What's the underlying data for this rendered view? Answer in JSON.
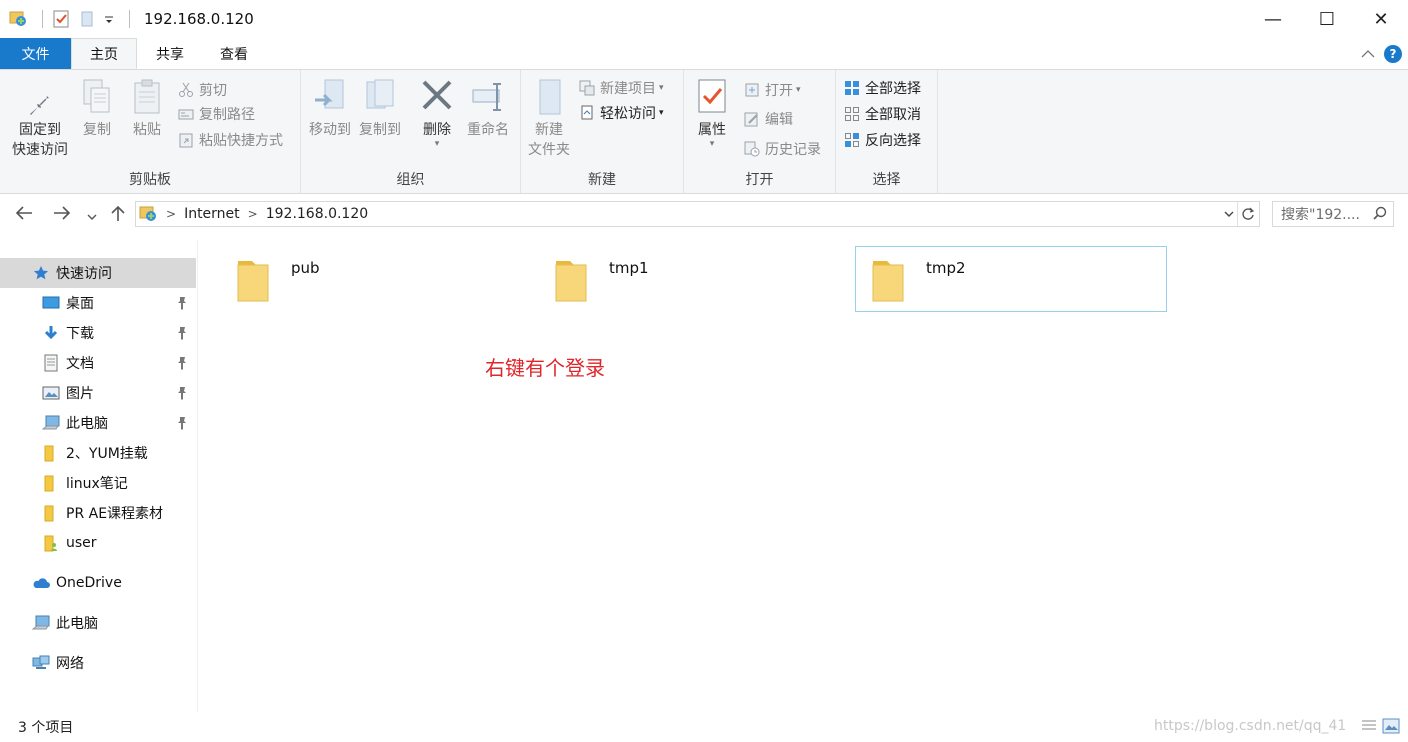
{
  "window": {
    "title": "192.168.0.120",
    "controls": {
      "minimize": "—",
      "maximize": "☐",
      "close": "✕"
    }
  },
  "ribbon_tabs": [
    {
      "label": "文件"
    },
    {
      "label": "主页"
    },
    {
      "label": "共享"
    },
    {
      "label": "查看"
    }
  ],
  "ribbon": {
    "clipboard": {
      "label": "剪贴板",
      "pin_quick_line1": "固定到",
      "pin_quick_line2": "快速访问",
      "copy": "复制",
      "paste": "粘贴",
      "cut": "剪切",
      "copy_path": "复制路径",
      "paste_shortcut": "粘贴快捷方式"
    },
    "organize": {
      "label": "组织",
      "move_to": "移动到",
      "copy_to": "复制到",
      "delete": "删除",
      "rename": "重命名"
    },
    "new": {
      "label": "新建",
      "new_folder_line1": "新建",
      "new_folder_line2": "文件夹",
      "new_item": "新建项目",
      "easy_access": "轻松访问"
    },
    "open": {
      "label": "打开",
      "properties": "属性",
      "open": "打开",
      "edit": "编辑",
      "history": "历史记录"
    },
    "select": {
      "label": "选择",
      "select_all": "全部选择",
      "select_none": "全部取消",
      "invert": "反向选择"
    }
  },
  "address": {
    "crumbs": [
      "Internet",
      "192.168.0.120"
    ],
    "search_placeholder": "搜索\"192...."
  },
  "sidebar": {
    "items": [
      {
        "label": "快速访问",
        "icon": "star-icon",
        "pinned": false
      },
      {
        "label": "桌面",
        "icon": "desktop-icon",
        "pinned": true
      },
      {
        "label": "下载",
        "icon": "download-icon",
        "pinned": true
      },
      {
        "label": "文档",
        "icon": "document-icon",
        "pinned": true
      },
      {
        "label": "图片",
        "icon": "picture-icon",
        "pinned": true
      },
      {
        "label": "此电脑",
        "icon": "computer-icon",
        "pinned": true
      },
      {
        "label": "2、YUM挂载",
        "icon": "folder-icon",
        "pinned": false
      },
      {
        "label": "linux笔记",
        "icon": "folder-icon",
        "pinned": false
      },
      {
        "label": "PR AE课程素材",
        "icon": "folder-icon",
        "pinned": false
      },
      {
        "label": "user",
        "icon": "user-folder-icon",
        "pinned": false
      },
      {
        "label": "OneDrive",
        "icon": "cloud-icon",
        "pinned": false
      },
      {
        "label": "此电脑",
        "icon": "computer-icon",
        "pinned": false
      },
      {
        "label": "网络",
        "icon": "network-icon",
        "pinned": false
      }
    ]
  },
  "content": {
    "folders": [
      {
        "name": "pub"
      },
      {
        "name": "tmp1"
      },
      {
        "name": "tmp2"
      }
    ],
    "annotation": "右键有个登录"
  },
  "status": {
    "count": "3 个项目",
    "watermark": "https://blog.csdn.net/qq_41"
  },
  "colors": {
    "accent": "#1979ca",
    "ribbon_bg": "#f5f6f7",
    "selection_border": "#99d1e8",
    "annotation": "#e0262a",
    "folder": "#f5c842"
  }
}
